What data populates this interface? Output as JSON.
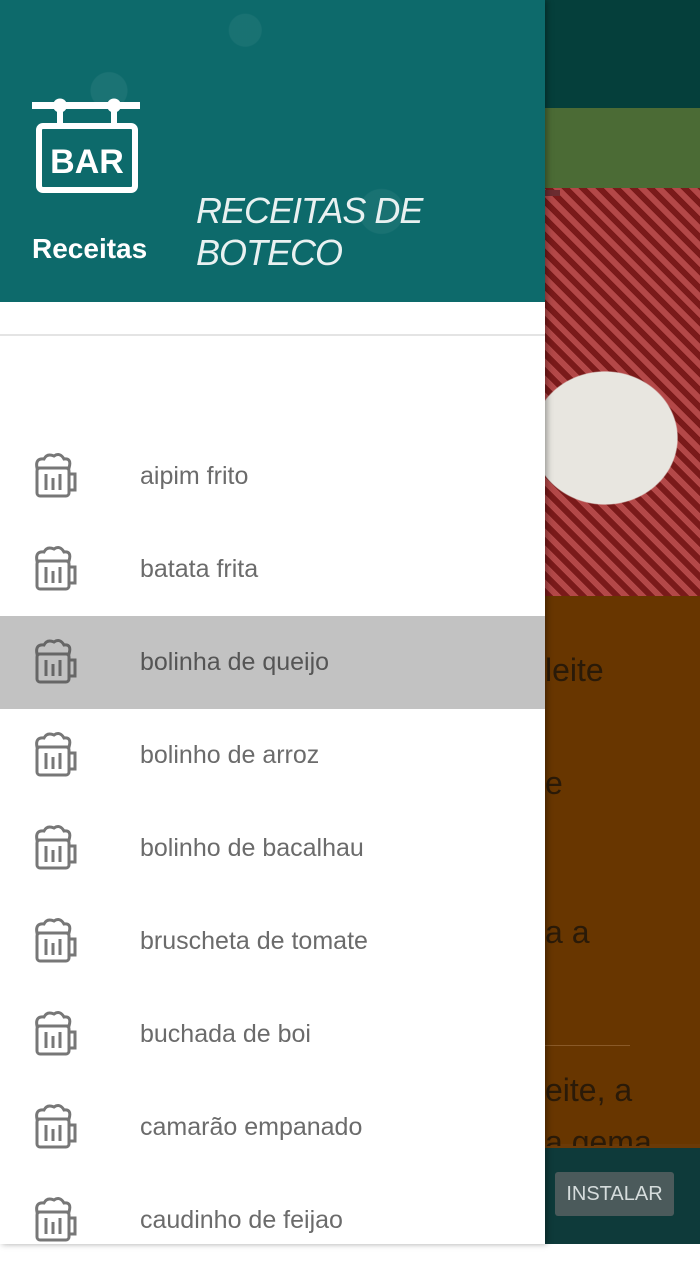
{
  "background": {
    "text_lines": [
      "leite",
      "e",
      "a a",
      "eite, a",
      "a gema"
    ],
    "install_button": "INSTALAR"
  },
  "drawer": {
    "header": {
      "logo_text": "BAR",
      "title": "Receitas",
      "brand": "RECEITAS DE BOTECO"
    },
    "items": [
      {
        "label": "aipim frito",
        "icon": "beer-mug-icon"
      },
      {
        "label": "batata frita",
        "icon": "beer-mug-icon"
      },
      {
        "label": "bolinha de queijo",
        "icon": "beer-mug-icon",
        "selected": true
      },
      {
        "label": "bolinho de arroz",
        "icon": "beer-mug-icon"
      },
      {
        "label": "bolinho de bacalhau",
        "icon": "beer-mug-icon"
      },
      {
        "label": "bruscheta de tomate",
        "icon": "beer-mug-icon"
      },
      {
        "label": "buchada de boi",
        "icon": "beer-mug-icon"
      },
      {
        "label": "camarão empanado",
        "icon": "beer-mug-icon"
      },
      {
        "label": "caudinho de feijao",
        "icon": "beer-mug-icon"
      }
    ]
  },
  "colors": {
    "header": "#0d6a6b",
    "selected_item": "#c2c2c2",
    "background_panel": "#683600"
  }
}
